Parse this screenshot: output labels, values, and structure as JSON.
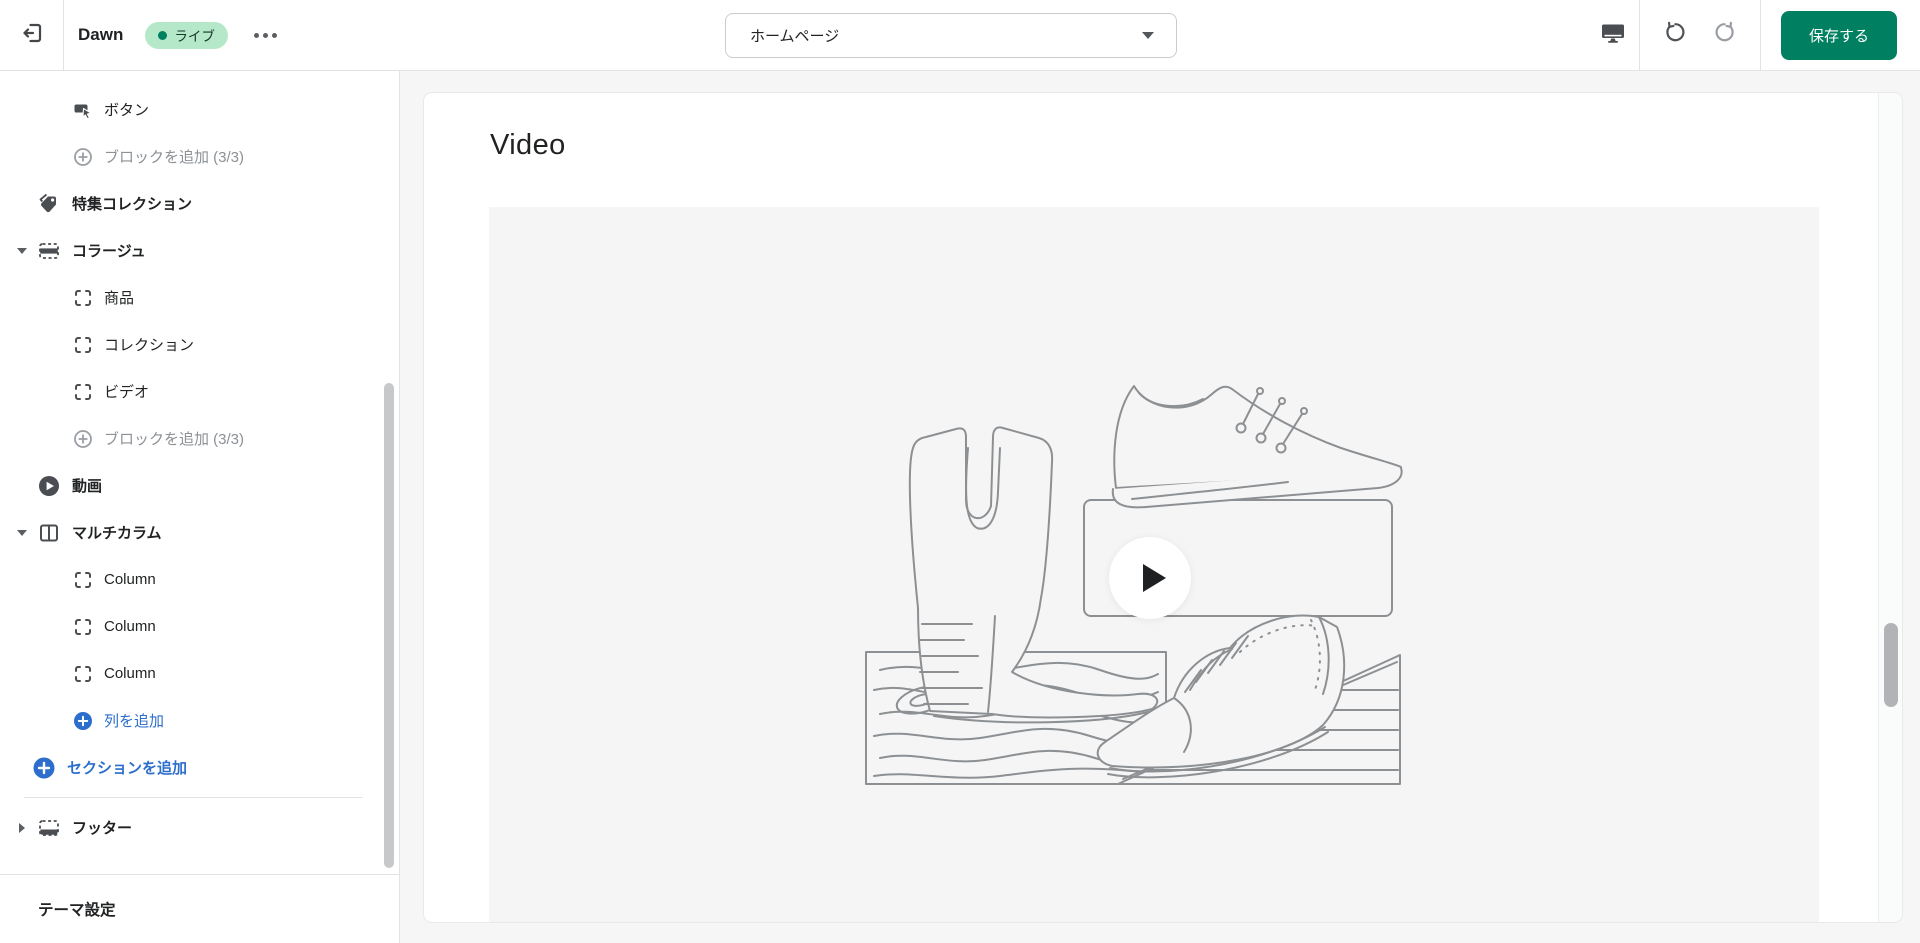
{
  "topbar": {
    "theme_name": "Dawn",
    "live_badge": "ライブ",
    "page_selector": "ホームページ",
    "save_label": "保存する"
  },
  "sidebar": {
    "items": [
      {
        "label": "ボタン"
      },
      {
        "label": "ブロックを追加 (3/3)"
      },
      {
        "label": "特集コレクション"
      },
      {
        "label": "コラージュ"
      },
      {
        "label": "商品"
      },
      {
        "label": "コレクション"
      },
      {
        "label": "ビデオ"
      },
      {
        "label": "ブロックを追加 (3/3)"
      },
      {
        "label": "動画"
      },
      {
        "label": "マルチカラム"
      },
      {
        "label": "Column"
      },
      {
        "label": "Column"
      },
      {
        "label": "Column"
      },
      {
        "label": "列を追加"
      },
      {
        "label": "セクションを追加"
      },
      {
        "label": "フッター"
      }
    ],
    "theme_settings_label": "テーマ設定"
  },
  "canvas": {
    "section_heading": "Video"
  },
  "colors": {
    "accent_green": "#008060",
    "badge_bg": "#b5e8c9",
    "badge_dot": "#00805f",
    "badge_text": "#14352a",
    "link_blue": "#2c6ecb",
    "text": "#202223",
    "subdued_text": "#8c9196",
    "icon_gray": "#5c5f62",
    "border": "#e1e3e5",
    "editor_bg": "#f6f6f7",
    "placeholder_bg": "#f5f5f6"
  }
}
